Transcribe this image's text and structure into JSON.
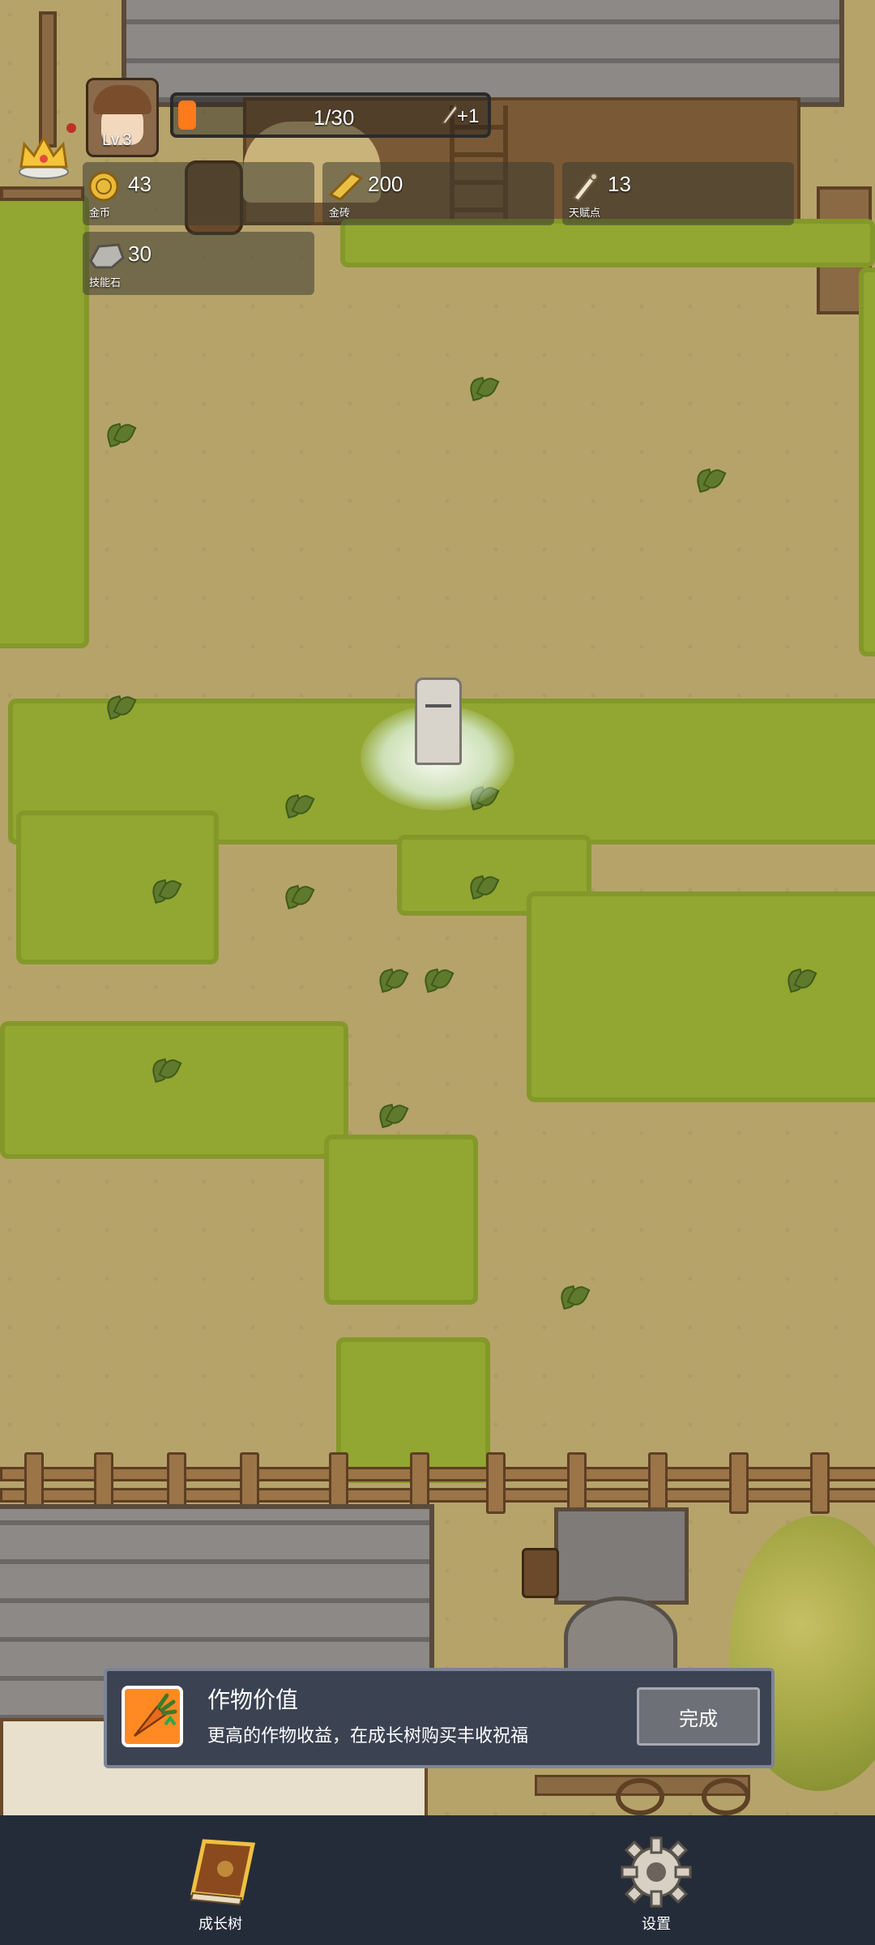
{
  "player": {
    "level_label": "Lv.3"
  },
  "xp_bar": {
    "text": "1/30",
    "bonus": "+1",
    "progress": 0.033,
    "fill_color": "#ff7a1a"
  },
  "resources": [
    {
      "id": "gold-coin",
      "icon": "gold-coin-icon",
      "value": "43",
      "label": "金币"
    },
    {
      "id": "gold-brick",
      "icon": "gold-brick-icon",
      "value": "200",
      "label": "金砖"
    },
    {
      "id": "talent-point",
      "icon": "scroll-icon",
      "value": "13",
      "label": "天赋点"
    },
    {
      "id": "skill-stone",
      "icon": "stone-icon",
      "value": "30",
      "label": "技能石"
    }
  ],
  "tutorial": {
    "title": "作物价值",
    "description": "更高的作物收益，在成长树购买丰收祝福",
    "button_label": "完成",
    "icon": "carrot-icon"
  },
  "bottom_nav": [
    {
      "label": "成长树",
      "icon": "book-icon"
    },
    {
      "label": "设置",
      "icon": "gear-icon"
    }
  ],
  "colors": {
    "grass": "#92a632",
    "dirt": "#b6a36a",
    "panel": "#3b4252",
    "bottom_bar": "#252c39"
  }
}
